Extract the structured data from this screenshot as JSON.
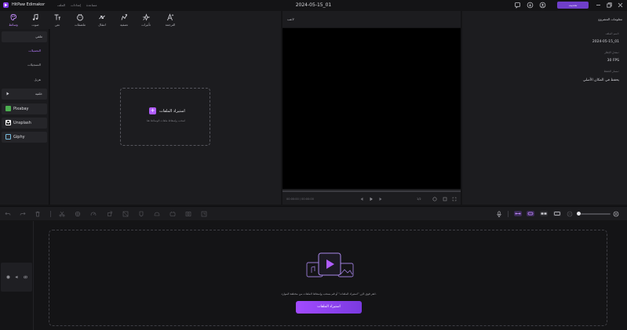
{
  "app": {
    "name": "HitPaw Edimakor",
    "project_title": "2024-05-15_01",
    "upgrade_label": "تحديث"
  },
  "menu": [
    "الملف",
    "إعدادات",
    "مساعدة"
  ],
  "toolbar": {
    "tools": [
      {
        "label": "وسائط",
        "icon": "media-icon",
        "active": true
      },
      {
        "label": "صوت",
        "icon": "music-note-icon"
      },
      {
        "label": "نص",
        "icon": "text-icon"
      },
      {
        "label": "ملصقات",
        "icon": "sticker-icon"
      },
      {
        "label": "انتقال",
        "icon": "transition-icon"
      },
      {
        "label": "تصفية",
        "icon": "filter-icon"
      },
      {
        "label": "تأثيرات",
        "icon": "effects-icon"
      },
      {
        "label": "الترجمة",
        "icon": "translate-icon"
      }
    ]
  },
  "sidebar": {
    "sections": [
      {
        "label": "ملفي",
        "expanded": true
      },
      {
        "label": "خلفية",
        "expanded": false
      }
    ],
    "sub_items": [
      {
        "label": "التحميلات",
        "active": true
      },
      {
        "label": "التسجيلات",
        "active": false
      },
      {
        "label": "هزيل",
        "active": false
      }
    ],
    "sources": [
      {
        "label": "Pixabay",
        "color": "#4caf50"
      },
      {
        "label": "Unsplash",
        "color": "#ffffff"
      },
      {
        "label": "Giphy",
        "color": "#2a2a2e"
      }
    ]
  },
  "media": {
    "import_label": "استيراد الملفات",
    "import_hint": "اسحب وإسقاط ملفات الوسائط هنا"
  },
  "player": {
    "title": "لاعب",
    "timecode": "00:00:00 / 00:00:00",
    "quality": "1/2"
  },
  "project_info": {
    "title": "معلومات المشروع",
    "name_label": "اسم الملف:",
    "name_value": "2024-05-15_01",
    "fps_label": "معدل الإطار:",
    "fps_value": "30 FPS",
    "location_label": "مسار الحفظ:",
    "location_value": "يحفظ في المكان الأصلي"
  },
  "timeline": {
    "drop_text": "انقر فوق الزر \"استيراد الملفات\" أو قم بسحب وإسقاط الملفات من مختلفة الموارد.",
    "drop_button": "استيراد الملفات"
  },
  "colors": {
    "accent": "#a24bff",
    "panel": "#1c1c1f",
    "background": "#141416"
  }
}
